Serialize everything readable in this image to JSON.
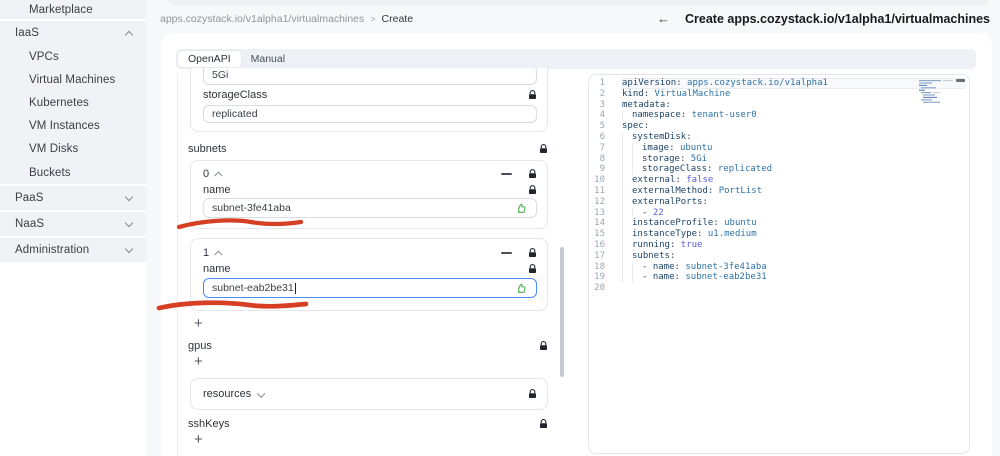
{
  "sidebar": {
    "sections": [
      {
        "items": [
          {
            "label": "Marketplace"
          }
        ]
      },
      {
        "header": {
          "label": "IaaS",
          "chevron": "up"
        },
        "items": [
          {
            "label": "VPCs"
          },
          {
            "label": "Virtual Machines"
          },
          {
            "label": "Kubernetes"
          },
          {
            "label": "VM Instances"
          },
          {
            "label": "VM Disks"
          },
          {
            "label": "Buckets"
          }
        ]
      },
      {
        "header": {
          "label": "PaaS",
          "chevron": "down"
        },
        "items": []
      },
      {
        "header": {
          "label": "NaaS",
          "chevron": "down"
        },
        "items": []
      },
      {
        "header": {
          "label": "Administration",
          "chevron": "down"
        },
        "items": []
      }
    ]
  },
  "header": {
    "breadcrumb": {
      "path": "apps.cozystack.io/v1alpha1/virtualmachines",
      "separator": ">",
      "current": "Create"
    },
    "back_icon": "←",
    "page_title": "Create apps.cozystack.io/v1alpha1/virtualmachines"
  },
  "tabs": [
    {
      "label": "OpenAPI",
      "active": true
    },
    {
      "label": "Manual",
      "active": false
    }
  ],
  "form": {
    "storage_value": "5Gi",
    "storage_class": {
      "label": "storageClass",
      "value": "replicated"
    },
    "subnets": {
      "label": "subnets",
      "items": [
        {
          "index": "0",
          "field_label": "name",
          "value": "subnet-3fe41aba",
          "focused": false
        },
        {
          "index": "1",
          "field_label": "name",
          "value": "subnet-eab2be31",
          "focused": true
        }
      ],
      "add_label": "+"
    },
    "gpus": {
      "label": "gpus",
      "add_label": "+"
    },
    "resources": {
      "label": "resources"
    },
    "sshKeys": {
      "label": "sshKeys",
      "add_label": "+"
    }
  },
  "editor": {
    "active_line": 1,
    "lines": [
      {
        "n": "1",
        "ind": 0,
        "segs": [
          [
            "k",
            "apiVersion"
          ],
          [
            "p",
            ": "
          ],
          [
            "s",
            "apps.cozystack.io/v1alpha1"
          ]
        ]
      },
      {
        "n": "2",
        "ind": 0,
        "segs": [
          [
            "k",
            "kind"
          ],
          [
            "p",
            ": "
          ],
          [
            "s",
            "VirtualMachine"
          ]
        ]
      },
      {
        "n": "3",
        "ind": 0,
        "segs": [
          [
            "k",
            "metadata"
          ],
          [
            "p",
            ":"
          ]
        ]
      },
      {
        "n": "4",
        "ind": 1,
        "segs": [
          [
            "k",
            "namespace"
          ],
          [
            "p",
            ": "
          ],
          [
            "s",
            "tenant-user0"
          ]
        ]
      },
      {
        "n": "5",
        "ind": 0,
        "segs": [
          [
            "k",
            "spec"
          ],
          [
            "p",
            ":"
          ]
        ]
      },
      {
        "n": "6",
        "ind": 1,
        "segs": [
          [
            "k",
            "systemDisk"
          ],
          [
            "p",
            ":"
          ]
        ]
      },
      {
        "n": "7",
        "ind": 2,
        "segs": [
          [
            "k",
            "image"
          ],
          [
            "p",
            ": "
          ],
          [
            "s",
            "ubuntu"
          ]
        ]
      },
      {
        "n": "8",
        "ind": 2,
        "segs": [
          [
            "k",
            "storage"
          ],
          [
            "p",
            ": "
          ],
          [
            "s",
            "5Gi"
          ]
        ]
      },
      {
        "n": "9",
        "ind": 2,
        "segs": [
          [
            "k",
            "storageClass"
          ],
          [
            "p",
            ": "
          ],
          [
            "s",
            "replicated"
          ]
        ]
      },
      {
        "n": "10",
        "ind": 1,
        "segs": [
          [
            "k",
            "external"
          ],
          [
            "p",
            ": "
          ],
          [
            "b",
            "false"
          ]
        ]
      },
      {
        "n": "11",
        "ind": 1,
        "segs": [
          [
            "k",
            "externalMethod"
          ],
          [
            "p",
            ": "
          ],
          [
            "s",
            "PortList"
          ]
        ]
      },
      {
        "n": "12",
        "ind": 1,
        "segs": [
          [
            "k",
            "externalPorts"
          ],
          [
            "p",
            ":"
          ]
        ]
      },
      {
        "n": "13",
        "ind": 2,
        "segs": [
          [
            "p",
            "- "
          ],
          [
            "b",
            "22"
          ]
        ]
      },
      {
        "n": "14",
        "ind": 1,
        "segs": [
          [
            "k",
            "instanceProfile"
          ],
          [
            "p",
            ": "
          ],
          [
            "s",
            "ubuntu"
          ]
        ]
      },
      {
        "n": "15",
        "ind": 1,
        "segs": [
          [
            "k",
            "instanceType"
          ],
          [
            "p",
            ": "
          ],
          [
            "s",
            "u1.medium"
          ]
        ]
      },
      {
        "n": "16",
        "ind": 1,
        "segs": [
          [
            "k",
            "running"
          ],
          [
            "p",
            ": "
          ],
          [
            "b",
            "true"
          ]
        ]
      },
      {
        "n": "17",
        "ind": 1,
        "segs": [
          [
            "k",
            "subnets"
          ],
          [
            "p",
            ":"
          ]
        ]
      },
      {
        "n": "18",
        "ind": 2,
        "segs": [
          [
            "p",
            "- "
          ],
          [
            "k",
            "name"
          ],
          [
            "p",
            ": "
          ],
          [
            "s",
            "subnet-3fe41aba"
          ]
        ]
      },
      {
        "n": "19",
        "ind": 2,
        "segs": [
          [
            "p",
            "- "
          ],
          [
            "k",
            "name"
          ],
          [
            "p",
            ": "
          ],
          [
            "s",
            "subnet-eab2be31"
          ]
        ]
      },
      {
        "n": "20",
        "ind": 0,
        "segs": []
      }
    ]
  },
  "colors": {
    "annotation_red": "#d43517",
    "thumb_green": "#4fae54",
    "focus_blue": "#4a8df0",
    "yaml_key": "#1d4468",
    "yaml_string": "#2f73a7",
    "yaml_literal": "#5a5cd6"
  }
}
